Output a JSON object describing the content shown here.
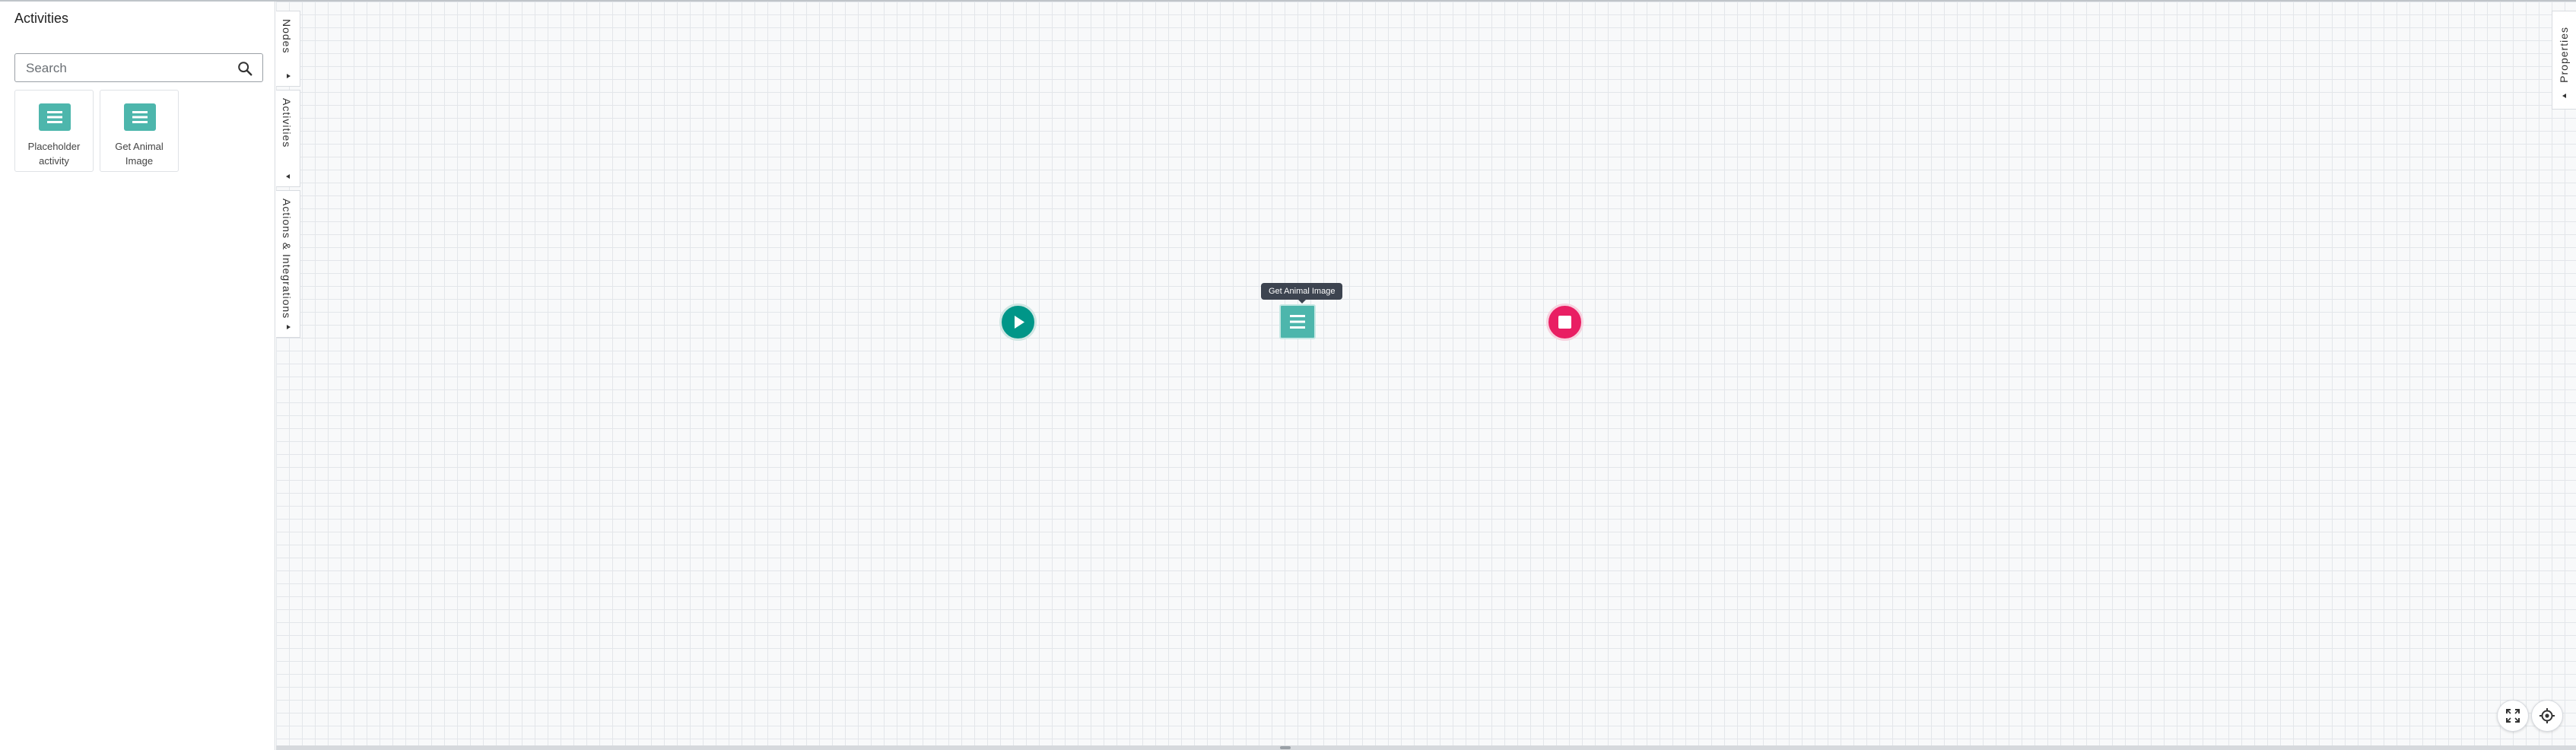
{
  "left_panel": {
    "title": "Activities",
    "search": {
      "placeholder": "Search",
      "value": ""
    },
    "items": [
      {
        "label": "Placeholder activity",
        "icon": "list-icon"
      },
      {
        "label": "Get Animal Image",
        "icon": "list-icon"
      }
    ]
  },
  "side_tabs": [
    {
      "label": "Nodes"
    },
    {
      "label": "Activities"
    },
    {
      "label": "Actions & Integrations"
    }
  ],
  "right_tab": {
    "label": "Properties"
  },
  "canvas": {
    "tooltip": "Get Animal Image",
    "nodes": [
      {
        "type": "start",
        "icon": "play-icon"
      },
      {
        "type": "activity",
        "label": "Get Animal Image",
        "icon": "list-icon"
      },
      {
        "type": "end",
        "icon": "stop-icon"
      }
    ]
  },
  "controls": [
    {
      "name": "fit-view",
      "icon": "fullscreen-icon"
    },
    {
      "name": "center",
      "icon": "crosshair-icon"
    }
  ],
  "colors": {
    "accent_teal": "#4db6ac",
    "start_green": "#009688",
    "end_pink": "#e91e63",
    "canvas_bg": "#f8f9fa",
    "grid_line": "#e3e6ea"
  }
}
